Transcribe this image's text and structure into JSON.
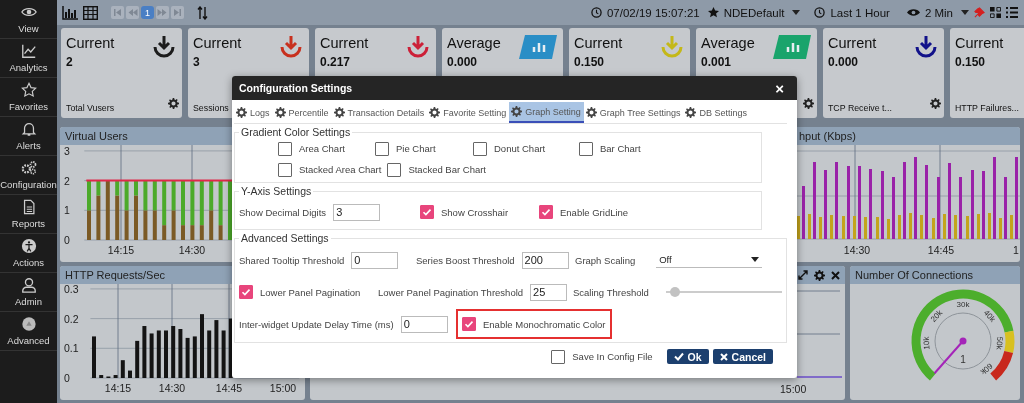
{
  "sidebar": {
    "items": [
      {
        "label": "View"
      },
      {
        "label": "Analytics"
      },
      {
        "label": "Favorites"
      },
      {
        "label": "Alerts"
      },
      {
        "label": "Configuration"
      },
      {
        "label": "Reports"
      },
      {
        "label": "Actions"
      },
      {
        "label": "Admin"
      },
      {
        "label": "Advanced"
      }
    ]
  },
  "toolbar": {
    "page": "1",
    "datetime": "07/02/19 15:07:21",
    "profile": "NDEDefault",
    "range": "Last 1 Hour",
    "interval": "2 Min"
  },
  "cards": [
    {
      "title": "Current",
      "value": "2",
      "label": "Total Vusers",
      "kind": "arrow",
      "color": "#1c1c1c",
      "gear": true
    },
    {
      "title": "Current",
      "value": "3",
      "label": "Sessions",
      "kind": "arrow",
      "color": "#c8301e"
    },
    {
      "title": "Current",
      "value": "0.217",
      "kind": "arrow",
      "color": "#cc2038"
    },
    {
      "title": "Average",
      "value": "0.000",
      "kind": "tile",
      "color": "#2a8ec6"
    },
    {
      "title": "Current",
      "value": "0.150",
      "kind": "arrow",
      "color": "#c4b818"
    },
    {
      "title": "Average",
      "value": "0.001",
      "kind": "tile",
      "color": "#1aa46c",
      "gear": true
    },
    {
      "title": "Current",
      "value": "0.000",
      "label": "TCP Receive t...",
      "kind": "arrow",
      "color": "#12128a",
      "gear": true
    },
    {
      "title": "Current",
      "value": "0.150",
      "label": "HTTP Failures..."
    }
  ],
  "panels": [
    {
      "kind": "chart",
      "title": "Virtual Users",
      "x_labels": [
        "14:15",
        "14:30"
      ],
      "chart_data": {
        "type": "bar",
        "stacked": true,
        "grid": true,
        "ylim": [
          0,
          3
        ],
        "yticks": [
          0,
          1,
          2,
          3
        ],
        "series": [
          {
            "color": "#7b5a25",
            "values": [
              1,
              1.5,
              2,
              1.5,
              1,
              1.5,
              1,
              1,
              0.5,
              1,
              0.5,
              0.5,
              0.5,
              1,
              0.5,
              0,
              null,
              null,
              null,
              null,
              null,
              null,
              null,
              null,
              null,
              null,
              null,
              null,
              null,
              null,
              null,
              null,
              null,
              null,
              null,
              null,
              null,
              null,
              null,
              null,
              null,
              null,
              null,
              null,
              null,
              null,
              null,
              null
            ]
          },
          {
            "color": "#4caa2a",
            "values": [
              1,
              0.5,
              0,
              0.5,
              1,
              0.5,
              1,
              1,
              1.5,
              1,
              1.5,
              1.5,
              1.5,
              1,
              1.5,
              2,
              null,
              null,
              null,
              null,
              null,
              null,
              null,
              null,
              null,
              null,
              null,
              null,
              null,
              null,
              null,
              null,
              null,
              null,
              null,
              null,
              null,
              null,
              null,
              null,
              null,
              null,
              null,
              null,
              null,
              null,
              null,
              null
            ]
          }
        ],
        "ref_lines": [
          {
            "axis": "y",
            "value": 2,
            "color": "#e0284a"
          }
        ]
      }
    },
    {
      "kind": "bars_picture",
      "title": "hput (Kbps)",
      "x_labels": [
        "14:30",
        "14:45",
        "1"
      ]
    },
    {
      "kind": "chart",
      "title": "HTTP Requests/Sec",
      "x_labels": [
        "14:15",
        "14:30",
        "14:45",
        "15:00"
      ],
      "chart_data": {
        "type": "bar",
        "grid": true,
        "ylim": [
          0,
          0.3
        ],
        "yticks": [
          0,
          0.1,
          0.2,
          0.3
        ],
        "series": [
          {
            "color": "#141414",
            "values": [
              0.14,
              0.01,
              0.005,
              0.01,
              0.06,
              0.025,
              0.125,
              0.175,
              0.15,
              0.16,
              0.16,
              0.175,
              0.165,
              0.135,
              0.14,
              0.215,
              0.16,
              0.195,
              0.16,
              0.2,
              null,
              null,
              null,
              null,
              null,
              null,
              null,
              null,
              null
            ]
          }
        ]
      }
    },
    {
      "kind": "line_picture",
      "x_labels": [
        "15:00"
      ]
    },
    {
      "kind": "gauge",
      "title": "Number Of Connections",
      "labels": [
        "10k",
        "20k",
        "30k",
        "40k",
        "50k",
        "60k"
      ],
      "value": "1"
    }
  ],
  "dialog": {
    "title": "Configuration Settings",
    "close": "×",
    "tabs": [
      {
        "label": "Logs",
        "selected": false
      },
      {
        "label": "Percentile",
        "selected": false
      },
      {
        "label": "Transaction Details",
        "selected": false
      },
      {
        "label": "Favorite Setting",
        "selected": false
      },
      {
        "label": "Graph Setting",
        "selected": true
      },
      {
        "label": "Graph Tree Settings",
        "selected": false
      },
      {
        "label": "DB Settings",
        "selected": false
      }
    ],
    "sections": [
      {
        "legend": "Gradient Color Settings",
        "rows": [
          [
            {
              "kind": "checkbox",
              "label": "Area Chart",
              "checked": false
            },
            {
              "kind": "checkbox",
              "label": "Pie Chart",
              "checked": false
            },
            {
              "kind": "checkbox",
              "label": "Donut Chart",
              "checked": false
            },
            {
              "kind": "checkbox",
              "label": "Bar Chart",
              "checked": false
            }
          ],
          [
            {
              "kind": "checkbox",
              "label": "Stacked Area Chart",
              "checked": false
            },
            {
              "kind": "checkbox",
              "label": "Stacked Bar Chart",
              "checked": false
            }
          ]
        ]
      },
      {
        "legend": "Y-Axis Settings",
        "rows": [
          [
            {
              "kind": "number",
              "label": "Show Decimal Digits",
              "value": "3"
            },
            {
              "kind": "checkbox",
              "label": "Show Crosshair",
              "checked": true
            },
            {
              "kind": "checkbox",
              "label": "Enable GridLine",
              "checked": true
            }
          ]
        ]
      },
      {
        "legend": "Advanced Settings",
        "rows": [
          [
            {
              "kind": "number",
              "label": "Shared Tooltip Threshold",
              "value": "0"
            },
            {
              "kind": "number",
              "label": "Series Boost Threshold",
              "value": "200"
            },
            {
              "kind": "select",
              "label": "Graph Scaling",
              "value": "Off"
            }
          ],
          [
            {
              "kind": "checkbox",
              "label": "Lower Panel Pagination",
              "checked": true
            },
            {
              "kind": "number",
              "label": "Lower Panel Pagination Threshold",
              "value": "25"
            },
            {
              "kind": "slider",
              "label": "Scaling Threshold",
              "level": 0.08
            }
          ],
          [
            {
              "kind": "number",
              "label": "Inter-widget Update Delay Time (ms)",
              "value": "0"
            },
            {
              "kind": "checkbox",
              "label": "Enable Monochromatic Color",
              "checked": true,
              "highlighted": true
            }
          ]
        ]
      }
    ],
    "save": {
      "label": "Save In Config File",
      "checked": false
    },
    "buttons": [
      {
        "kind": "ok",
        "label": "Ok"
      },
      {
        "kind": "cancel",
        "label": "Cancel"
      }
    ]
  }
}
